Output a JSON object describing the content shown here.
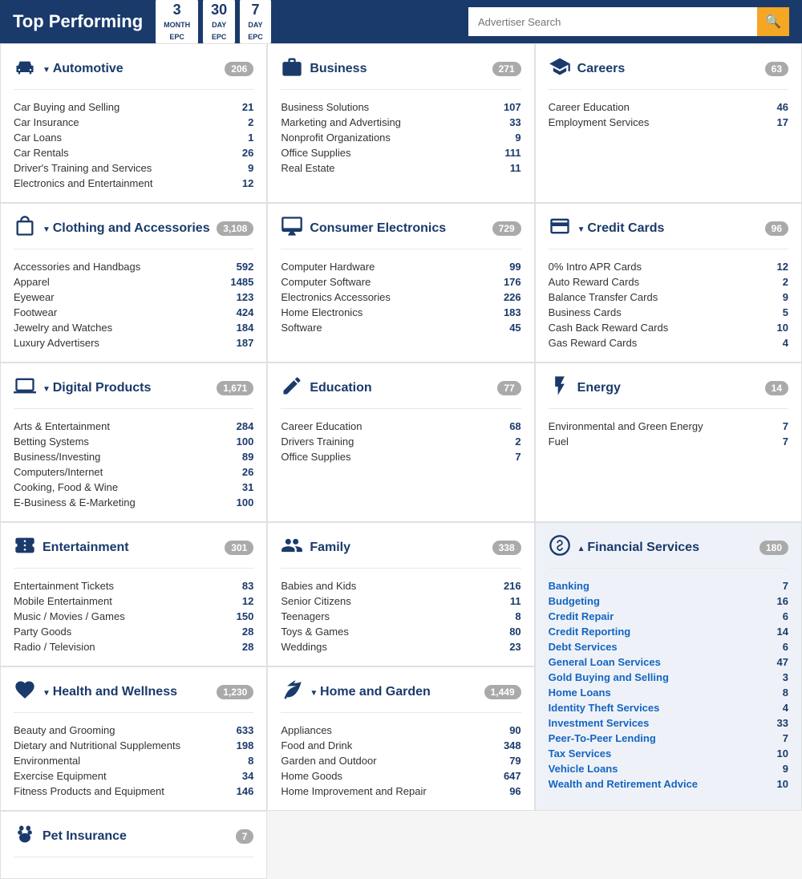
{
  "header": {
    "title": "Top Performing",
    "epc_buttons": [
      {
        "num": "3",
        "label": "MONTH EPC"
      },
      {
        "num": "30",
        "label": "DAY EPC"
      },
      {
        "num": "7",
        "label": "DAY EPC"
      }
    ],
    "search_placeholder": "Advertiser Search",
    "search_icon": "🔍"
  },
  "categories": [
    {
      "id": "automotive",
      "icon": "car",
      "title": "Automotive",
      "arrow": "down",
      "count": "206",
      "items": [
        {
          "name": "Car Buying and Selling",
          "count": "21"
        },
        {
          "name": "Car Insurance",
          "count": "2"
        },
        {
          "name": "Car Loans",
          "count": "1"
        },
        {
          "name": "Car Rentals",
          "count": "26"
        },
        {
          "name": "Driver's Training and Services",
          "count": "9"
        },
        {
          "name": "Electronics and Entertainment",
          "count": "12"
        }
      ]
    },
    {
      "id": "business",
      "icon": "briefcase",
      "title": "Business",
      "arrow": "none",
      "count": "271",
      "items": [
        {
          "name": "Business Solutions",
          "count": "107"
        },
        {
          "name": "Marketing and Advertising",
          "count": "33"
        },
        {
          "name": "Nonprofit Organizations",
          "count": "9"
        },
        {
          "name": "Office Supplies",
          "count": "111"
        },
        {
          "name": "Real Estate",
          "count": "11"
        }
      ]
    },
    {
      "id": "careers",
      "icon": "graduation",
      "title": "Careers",
      "arrow": "none",
      "count": "63",
      "items": [
        {
          "name": "Career Education",
          "count": "46"
        },
        {
          "name": "Employment Services",
          "count": "17"
        }
      ]
    },
    {
      "id": "clothing",
      "icon": "shopping",
      "title": "Clothing and Accessories",
      "arrow": "down",
      "count": "3,108",
      "items": [
        {
          "name": "Accessories and Handbags",
          "count": "592"
        },
        {
          "name": "Apparel",
          "count": "1485"
        },
        {
          "name": "Eyewear",
          "count": "123"
        },
        {
          "name": "Footwear",
          "count": "424"
        },
        {
          "name": "Jewelry and Watches",
          "count": "184"
        },
        {
          "name": "Luxury Advertisers",
          "count": "187"
        }
      ]
    },
    {
      "id": "consumer-electronics",
      "icon": "monitor",
      "title": "Consumer Electronics",
      "arrow": "none",
      "count": "729",
      "items": [
        {
          "name": "Computer Hardware",
          "count": "99"
        },
        {
          "name": "Computer Software",
          "count": "176"
        },
        {
          "name": "Electronics Accessories",
          "count": "226"
        },
        {
          "name": "Home Electronics",
          "count": "183"
        },
        {
          "name": "Software",
          "count": "45"
        }
      ]
    },
    {
      "id": "credit-cards",
      "icon": "creditcard",
      "title": "Credit Cards",
      "arrow": "down",
      "count": "96",
      "items": [
        {
          "name": "0% Intro APR Cards",
          "count": "12"
        },
        {
          "name": "Auto Reward Cards",
          "count": "2"
        },
        {
          "name": "Balance Transfer Cards",
          "count": "9"
        },
        {
          "name": "Business Cards",
          "count": "5"
        },
        {
          "name": "Cash Back Reward Cards",
          "count": "10"
        },
        {
          "name": "Gas Reward Cards",
          "count": "4"
        }
      ]
    },
    {
      "id": "digital-products",
      "icon": "laptop",
      "title": "Digital Products",
      "arrow": "down",
      "count": "1,671",
      "items": [
        {
          "name": "Arts & Entertainment",
          "count": "284"
        },
        {
          "name": "Betting Systems",
          "count": "100"
        },
        {
          "name": "Business/Investing",
          "count": "89"
        },
        {
          "name": "Computers/Internet",
          "count": "26"
        },
        {
          "name": "Cooking, Food & Wine",
          "count": "31"
        },
        {
          "name": "E-Business & E-Marketing",
          "count": "100"
        }
      ]
    },
    {
      "id": "education",
      "icon": "pencil",
      "title": "Education",
      "arrow": "none",
      "count": "77",
      "items": [
        {
          "name": "Career Education",
          "count": "68"
        },
        {
          "name": "Drivers Training",
          "count": "2"
        },
        {
          "name": "Office Supplies",
          "count": "7"
        }
      ]
    },
    {
      "id": "energy",
      "icon": "bolt",
      "title": "Energy",
      "arrow": "none",
      "count": "14",
      "items": [
        {
          "name": "Environmental and Green Energy",
          "count": "7"
        },
        {
          "name": "Fuel",
          "count": "7"
        }
      ]
    },
    {
      "id": "entertainment",
      "icon": "ticket",
      "title": "Entertainment",
      "arrow": "none",
      "count": "301",
      "items": [
        {
          "name": "Entertainment Tickets",
          "count": "83"
        },
        {
          "name": "Mobile Entertainment",
          "count": "12"
        },
        {
          "name": "Music / Movies / Games",
          "count": "150"
        },
        {
          "name": "Party Goods",
          "count": "28"
        },
        {
          "name": "Radio / Television",
          "count": "28"
        }
      ]
    },
    {
      "id": "family",
      "icon": "family",
      "title": "Family",
      "arrow": "none",
      "count": "338",
      "items": [
        {
          "name": "Babies and Kids",
          "count": "216"
        },
        {
          "name": "Senior Citizens",
          "count": "11"
        },
        {
          "name": "Teenagers",
          "count": "8"
        },
        {
          "name": "Toys & Games",
          "count": "80"
        },
        {
          "name": "Weddings",
          "count": "23"
        }
      ]
    },
    {
      "id": "financial-services",
      "icon": "dollar",
      "title": "Financial Services",
      "arrow": "up",
      "count": "180",
      "highlighted": true,
      "items": [
        {
          "name": "Banking",
          "count": "7"
        },
        {
          "name": "Budgeting",
          "count": "16"
        },
        {
          "name": "Credit Repair",
          "count": "6"
        },
        {
          "name": "Credit Reporting",
          "count": "14"
        },
        {
          "name": "Debt Services",
          "count": "6"
        },
        {
          "name": "General Loan Services",
          "count": "47"
        },
        {
          "name": "Gold Buying and Selling",
          "count": "3"
        },
        {
          "name": "Home Loans",
          "count": "8"
        },
        {
          "name": "Identity Theft Services",
          "count": "4"
        },
        {
          "name": "Investment Services",
          "count": "33"
        },
        {
          "name": "Peer-To-Peer Lending",
          "count": "7"
        },
        {
          "name": "Tax Services",
          "count": "10"
        },
        {
          "name": "Vehicle Loans",
          "count": "9"
        },
        {
          "name": "Wealth and Retirement Advice",
          "count": "10"
        }
      ]
    },
    {
      "id": "health-wellness",
      "icon": "heart",
      "title": "Health and Wellness",
      "arrow": "down",
      "count": "1,230",
      "items": [
        {
          "name": "Beauty and Grooming",
          "count": "633"
        },
        {
          "name": "Dietary and Nutritional Supplements",
          "count": "198"
        },
        {
          "name": "Environmental",
          "count": "8"
        },
        {
          "name": "Exercise Equipment",
          "count": "34"
        },
        {
          "name": "Fitness Products and Equipment",
          "count": "146"
        }
      ]
    },
    {
      "id": "home-garden",
      "icon": "leaf",
      "title": "Home and Garden",
      "arrow": "down",
      "count": "1,449",
      "items": [
        {
          "name": "Appliances",
          "count": "90"
        },
        {
          "name": "Food and Drink",
          "count": "348"
        },
        {
          "name": "Garden and Outdoor",
          "count": "79"
        },
        {
          "name": "Home Goods",
          "count": "647"
        },
        {
          "name": "Home Improvement and Repair",
          "count": "96"
        }
      ]
    },
    {
      "id": "pet-insurance",
      "icon": "paw",
      "title": "Pet Insurance",
      "arrow": "none",
      "count": "7",
      "items": []
    }
  ]
}
